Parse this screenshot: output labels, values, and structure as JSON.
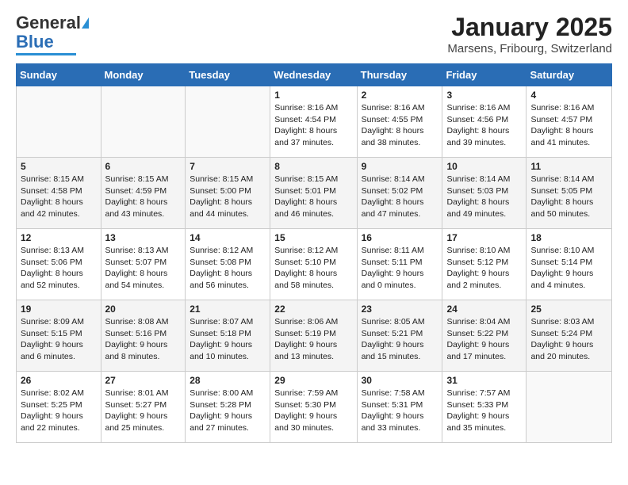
{
  "header": {
    "logo_general": "General",
    "logo_blue": "Blue",
    "month_title": "January 2025",
    "location": "Marsens, Fribourg, Switzerland"
  },
  "days_of_week": [
    "Sunday",
    "Monday",
    "Tuesday",
    "Wednesday",
    "Thursday",
    "Friday",
    "Saturday"
  ],
  "weeks": [
    [
      {
        "day": "",
        "info": ""
      },
      {
        "day": "",
        "info": ""
      },
      {
        "day": "",
        "info": ""
      },
      {
        "day": "1",
        "info": "Sunrise: 8:16 AM\nSunset: 4:54 PM\nDaylight: 8 hours and 37 minutes."
      },
      {
        "day": "2",
        "info": "Sunrise: 8:16 AM\nSunset: 4:55 PM\nDaylight: 8 hours and 38 minutes."
      },
      {
        "day": "3",
        "info": "Sunrise: 8:16 AM\nSunset: 4:56 PM\nDaylight: 8 hours and 39 minutes."
      },
      {
        "day": "4",
        "info": "Sunrise: 8:16 AM\nSunset: 4:57 PM\nDaylight: 8 hours and 41 minutes."
      }
    ],
    [
      {
        "day": "5",
        "info": "Sunrise: 8:15 AM\nSunset: 4:58 PM\nDaylight: 8 hours and 42 minutes."
      },
      {
        "day": "6",
        "info": "Sunrise: 8:15 AM\nSunset: 4:59 PM\nDaylight: 8 hours and 43 minutes."
      },
      {
        "day": "7",
        "info": "Sunrise: 8:15 AM\nSunset: 5:00 PM\nDaylight: 8 hours and 44 minutes."
      },
      {
        "day": "8",
        "info": "Sunrise: 8:15 AM\nSunset: 5:01 PM\nDaylight: 8 hours and 46 minutes."
      },
      {
        "day": "9",
        "info": "Sunrise: 8:14 AM\nSunset: 5:02 PM\nDaylight: 8 hours and 47 minutes."
      },
      {
        "day": "10",
        "info": "Sunrise: 8:14 AM\nSunset: 5:03 PM\nDaylight: 8 hours and 49 minutes."
      },
      {
        "day": "11",
        "info": "Sunrise: 8:14 AM\nSunset: 5:05 PM\nDaylight: 8 hours and 50 minutes."
      }
    ],
    [
      {
        "day": "12",
        "info": "Sunrise: 8:13 AM\nSunset: 5:06 PM\nDaylight: 8 hours and 52 minutes."
      },
      {
        "day": "13",
        "info": "Sunrise: 8:13 AM\nSunset: 5:07 PM\nDaylight: 8 hours and 54 minutes."
      },
      {
        "day": "14",
        "info": "Sunrise: 8:12 AM\nSunset: 5:08 PM\nDaylight: 8 hours and 56 minutes."
      },
      {
        "day": "15",
        "info": "Sunrise: 8:12 AM\nSunset: 5:10 PM\nDaylight: 8 hours and 58 minutes."
      },
      {
        "day": "16",
        "info": "Sunrise: 8:11 AM\nSunset: 5:11 PM\nDaylight: 9 hours and 0 minutes."
      },
      {
        "day": "17",
        "info": "Sunrise: 8:10 AM\nSunset: 5:12 PM\nDaylight: 9 hours and 2 minutes."
      },
      {
        "day": "18",
        "info": "Sunrise: 8:10 AM\nSunset: 5:14 PM\nDaylight: 9 hours and 4 minutes."
      }
    ],
    [
      {
        "day": "19",
        "info": "Sunrise: 8:09 AM\nSunset: 5:15 PM\nDaylight: 9 hours and 6 minutes."
      },
      {
        "day": "20",
        "info": "Sunrise: 8:08 AM\nSunset: 5:16 PM\nDaylight: 9 hours and 8 minutes."
      },
      {
        "day": "21",
        "info": "Sunrise: 8:07 AM\nSunset: 5:18 PM\nDaylight: 9 hours and 10 minutes."
      },
      {
        "day": "22",
        "info": "Sunrise: 8:06 AM\nSunset: 5:19 PM\nDaylight: 9 hours and 13 minutes."
      },
      {
        "day": "23",
        "info": "Sunrise: 8:05 AM\nSunset: 5:21 PM\nDaylight: 9 hours and 15 minutes."
      },
      {
        "day": "24",
        "info": "Sunrise: 8:04 AM\nSunset: 5:22 PM\nDaylight: 9 hours and 17 minutes."
      },
      {
        "day": "25",
        "info": "Sunrise: 8:03 AM\nSunset: 5:24 PM\nDaylight: 9 hours and 20 minutes."
      }
    ],
    [
      {
        "day": "26",
        "info": "Sunrise: 8:02 AM\nSunset: 5:25 PM\nDaylight: 9 hours and 22 minutes."
      },
      {
        "day": "27",
        "info": "Sunrise: 8:01 AM\nSunset: 5:27 PM\nDaylight: 9 hours and 25 minutes."
      },
      {
        "day": "28",
        "info": "Sunrise: 8:00 AM\nSunset: 5:28 PM\nDaylight: 9 hours and 27 minutes."
      },
      {
        "day": "29",
        "info": "Sunrise: 7:59 AM\nSunset: 5:30 PM\nDaylight: 9 hours and 30 minutes."
      },
      {
        "day": "30",
        "info": "Sunrise: 7:58 AM\nSunset: 5:31 PM\nDaylight: 9 hours and 33 minutes."
      },
      {
        "day": "31",
        "info": "Sunrise: 7:57 AM\nSunset: 5:33 PM\nDaylight: 9 hours and 35 minutes."
      },
      {
        "day": "",
        "info": ""
      }
    ]
  ]
}
